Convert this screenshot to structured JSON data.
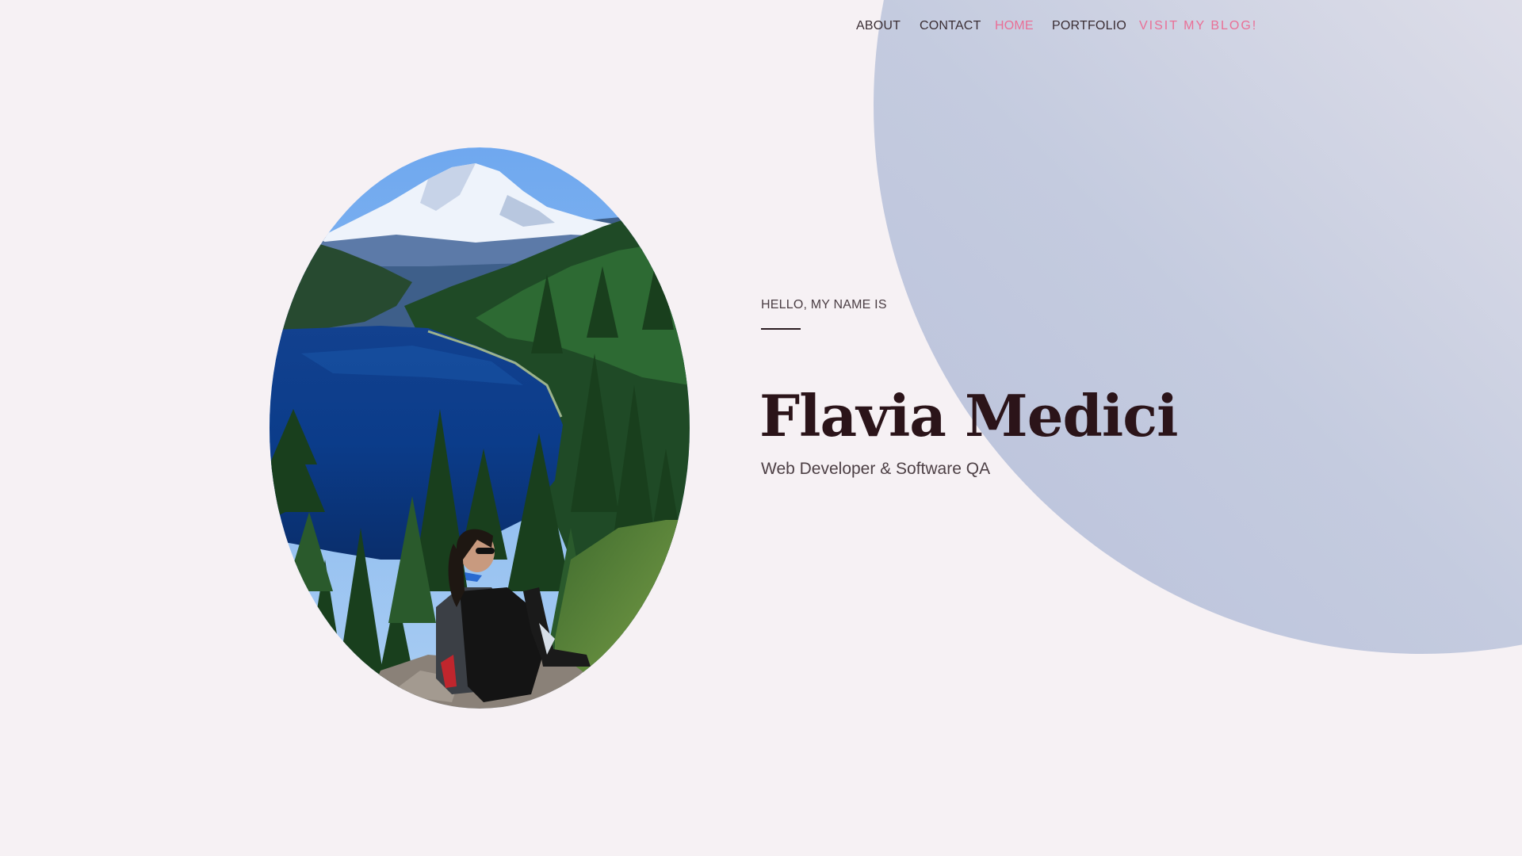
{
  "nav": {
    "items": [
      {
        "label": "ABOUT"
      },
      {
        "label": "CONTACT"
      },
      {
        "label": "HOME"
      },
      {
        "label": "PORTFOLIO"
      },
      {
        "label": "VISIT MY BLOG!"
      }
    ],
    "active": "HOME"
  },
  "hero": {
    "eyebrow": "HELLO, MY NAME IS",
    "name": "Flavia Medici",
    "role": "Web Developer & Software QA"
  },
  "portrait": {
    "subject": "person-with-backpack-overlooking-mountain-lake"
  },
  "colors": {
    "background": "#f6f1f4",
    "accent": "#ea6f96",
    "heading": "#2b1419",
    "text": "#4d4045",
    "circle_gradient": [
      "#f6f1f4",
      "#b9c1db"
    ]
  }
}
